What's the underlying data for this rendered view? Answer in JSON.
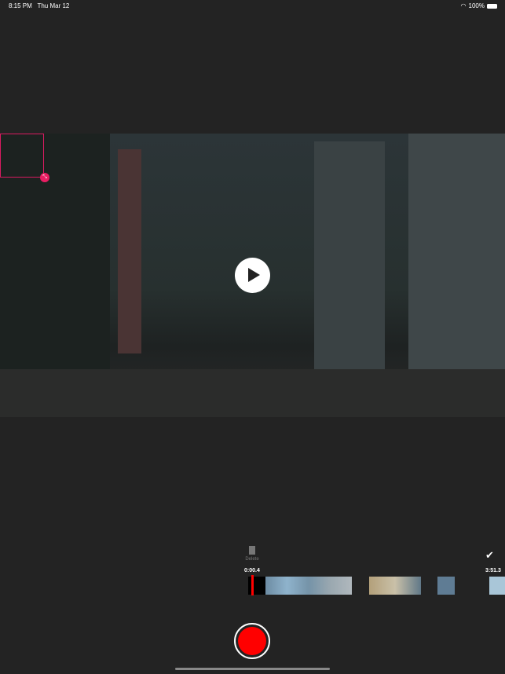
{
  "status": {
    "time": "8:15 PM",
    "date": "Thu Mar 12",
    "battery": "100%"
  },
  "editor": {
    "delete_label": "Delete",
    "start_time": "0:00.4",
    "end_time": "3:51.3",
    "confirm_icon": "checkmark-icon"
  }
}
